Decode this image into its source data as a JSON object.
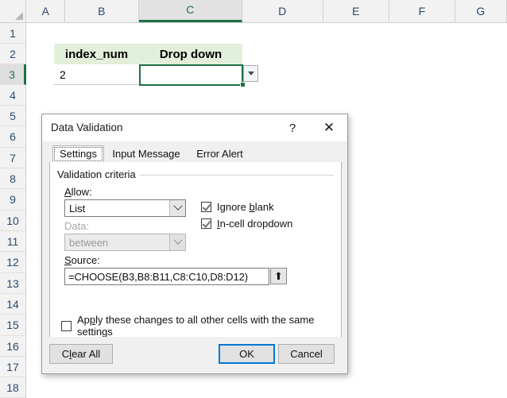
{
  "spreadsheet": {
    "columns": [
      "A",
      "B",
      "C",
      "D",
      "E",
      "F",
      "G"
    ],
    "selected_column": "C",
    "rows": [
      "1",
      "2",
      "3",
      "4",
      "5",
      "6",
      "7",
      "8",
      "9",
      "10",
      "11",
      "12",
      "13",
      "14",
      "15",
      "16",
      "17",
      "18"
    ],
    "selected_row": "3",
    "cells": {
      "b2": "index_num",
      "c2": "Drop down",
      "b3": "2",
      "c3": ""
    },
    "dropdown_icon": "dropdown-triangle-icon",
    "corner_icon": "select-all-corner-icon"
  },
  "dialog": {
    "title": "Data Validation",
    "help_icon": "?",
    "close_icon": "✕",
    "tabs": [
      {
        "label": "Settings",
        "active": true
      },
      {
        "label": "Input Message",
        "active": false
      },
      {
        "label": "Error Alert",
        "active": false
      }
    ],
    "group_title": "Validation criteria",
    "allow": {
      "label_prefix": "A",
      "label_rest": "llow:",
      "value": "List",
      "enabled": true
    },
    "data": {
      "label_prefix": "D",
      "label_rest": "ata:",
      "value": "between",
      "enabled": false
    },
    "source": {
      "label_prefix": "S",
      "label_rest": "ource:",
      "value": "=CHOOSE(B3,B8:B11,C8:C10,D8:D12)",
      "collapse_icon": "⬆",
      "collapse_icon_name": "collapse-dialog-icon"
    },
    "checkboxes": [
      {
        "pre": "Ignore ",
        "accel": "b",
        "post": "lank",
        "checked": true,
        "name": "ignore-blank"
      },
      {
        "pre": "",
        "accel": "I",
        "post": "n-cell dropdown",
        "checked": true,
        "name": "in-cell-dropdown"
      }
    ],
    "apply_all": {
      "pre": "Ap",
      "accel": "p",
      "post": "ly these changes to all other cells with the same settings",
      "checked": false
    },
    "buttons": [
      {
        "pre": "C",
        "accel": "l",
        "post": "ear All",
        "default": false,
        "name": "clear-all-button"
      },
      {
        "pre": "",
        "accel": "",
        "post": "OK",
        "default": true,
        "name": "ok-button"
      },
      {
        "pre": "",
        "accel": "",
        "post": "Cancel",
        "default": false,
        "name": "cancel-button"
      }
    ]
  },
  "colors": {
    "excel_green": "#1e7145",
    "header_fill": "#e2efda",
    "accent_blue": "#0078d7"
  }
}
